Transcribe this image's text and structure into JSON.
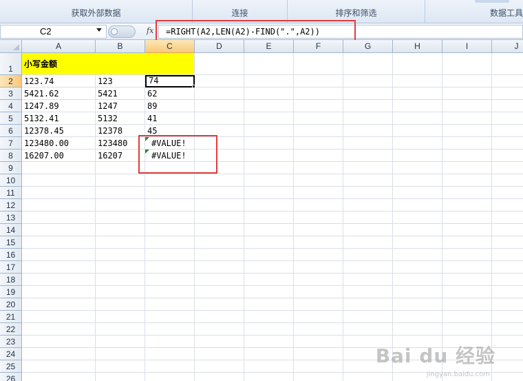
{
  "ribbon": {
    "groups": [
      "获取外部数据",
      "连接",
      "排序和筛选",
      "数据工具"
    ]
  },
  "formula_bar": {
    "name_box": "C2",
    "fx_label": "fx",
    "formula": "=RIGHT(A2,LEN(A2)-FIND(\".\",A2))"
  },
  "columns": [
    "A",
    "B",
    "C",
    "D",
    "E",
    "F",
    "G",
    "H",
    "I",
    "J"
  ],
  "rows": [
    "1",
    "2",
    "3",
    "4",
    "5",
    "6",
    "7",
    "8",
    "9",
    "10",
    "11",
    "12",
    "13",
    "14",
    "15",
    "16",
    "17",
    "18",
    "19",
    "20",
    "21",
    "22",
    "23",
    "24",
    "25",
    "26"
  ],
  "header_cell": "小写金额",
  "data_rows": [
    [
      "123.74",
      "123",
      "74"
    ],
    [
      "5421.62",
      "5421",
      "62"
    ],
    [
      "1247.89",
      "1247",
      "89"
    ],
    [
      "5132.41",
      "5132",
      "41"
    ],
    [
      "12378.45",
      "12378",
      "45"
    ],
    [
      "123480.00",
      "123480",
      "#VALUE!"
    ],
    [
      "16207.00",
      "16207",
      "#VALUE!"
    ]
  ],
  "watermark": {
    "main": "Bai du 经验",
    "sub": "jingyan.baidu.com"
  },
  "colors": {
    "header_fill": "#ffff00",
    "highlight_border": "#e23b3b",
    "error_indicator": "#1f8a3a"
  }
}
